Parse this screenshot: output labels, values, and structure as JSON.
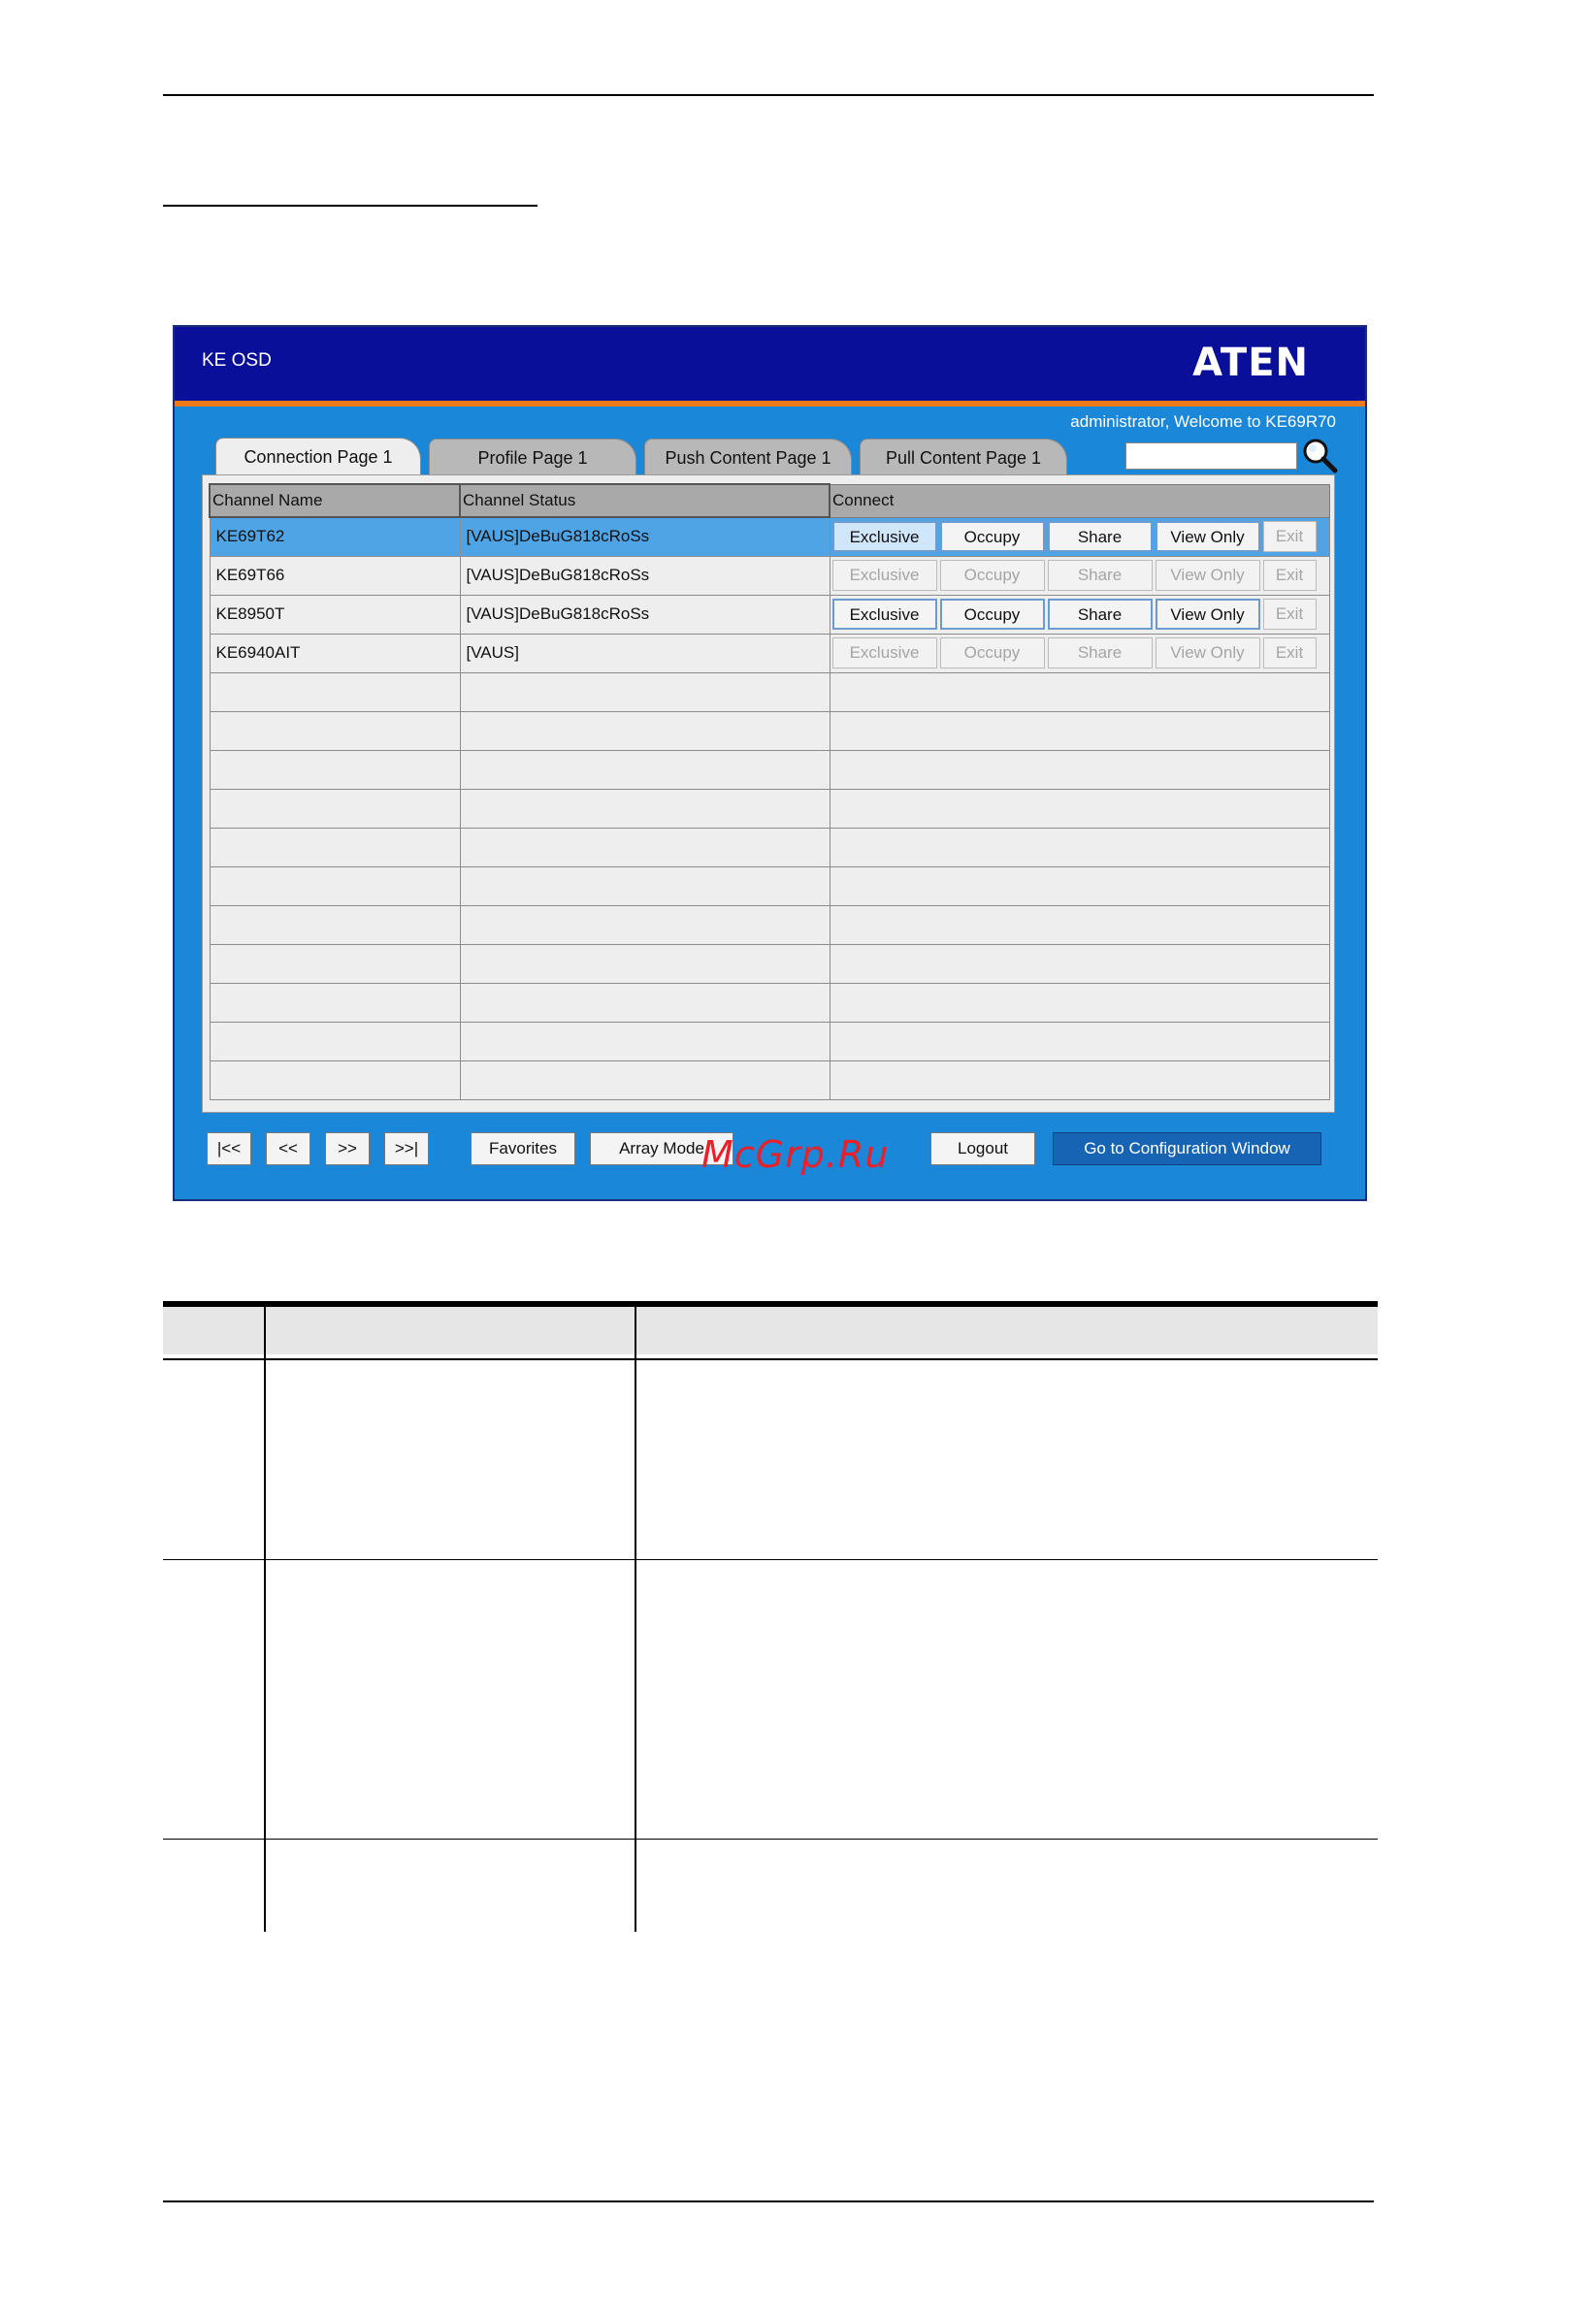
{
  "window": {
    "title": "KE OSD",
    "logo": "ATEN",
    "welcome": "administrator, Welcome to KE69R70"
  },
  "tabs": [
    {
      "label": "Connection Page 1",
      "active": true
    },
    {
      "label": "Profile Page 1",
      "active": false
    },
    {
      "label": "Push Content Page 1",
      "active": false
    },
    {
      "label": "Pull Content Page 1",
      "active": false
    }
  ],
  "search": {
    "value": "",
    "icon": "magnifier-icon"
  },
  "table": {
    "headers": [
      "Channel Name",
      "Channel Status",
      "Connect"
    ],
    "rows": [
      {
        "name": "KE69T62",
        "status": "[VAUS]DeBuG818cRoSs"
      },
      {
        "name": "KE69T66",
        "status": "[VAUS]DeBuG818cRoSs"
      },
      {
        "name": "KE8950T",
        "status": "[VAUS]DeBuG818cRoSs"
      },
      {
        "name": "KE6940AIT",
        "status": "[VAUS]"
      }
    ],
    "buttons": [
      "Exclusive",
      "Occupy",
      "Share",
      "View Only",
      "Exit"
    ]
  },
  "nav": {
    "first": "|<<",
    "prev": "<<",
    "next": ">>",
    "last": ">>|",
    "favorites": "Favorites",
    "array_mode": "Array Mode",
    "logout": "Logout",
    "config": "Go to Configuration Window"
  },
  "watermark": "McGrp.Ru",
  "colors": {
    "header": "#0a0f9a",
    "accent": "#f07a1a",
    "body": "#1a87d8",
    "selected_row": "#4fa4e6"
  }
}
